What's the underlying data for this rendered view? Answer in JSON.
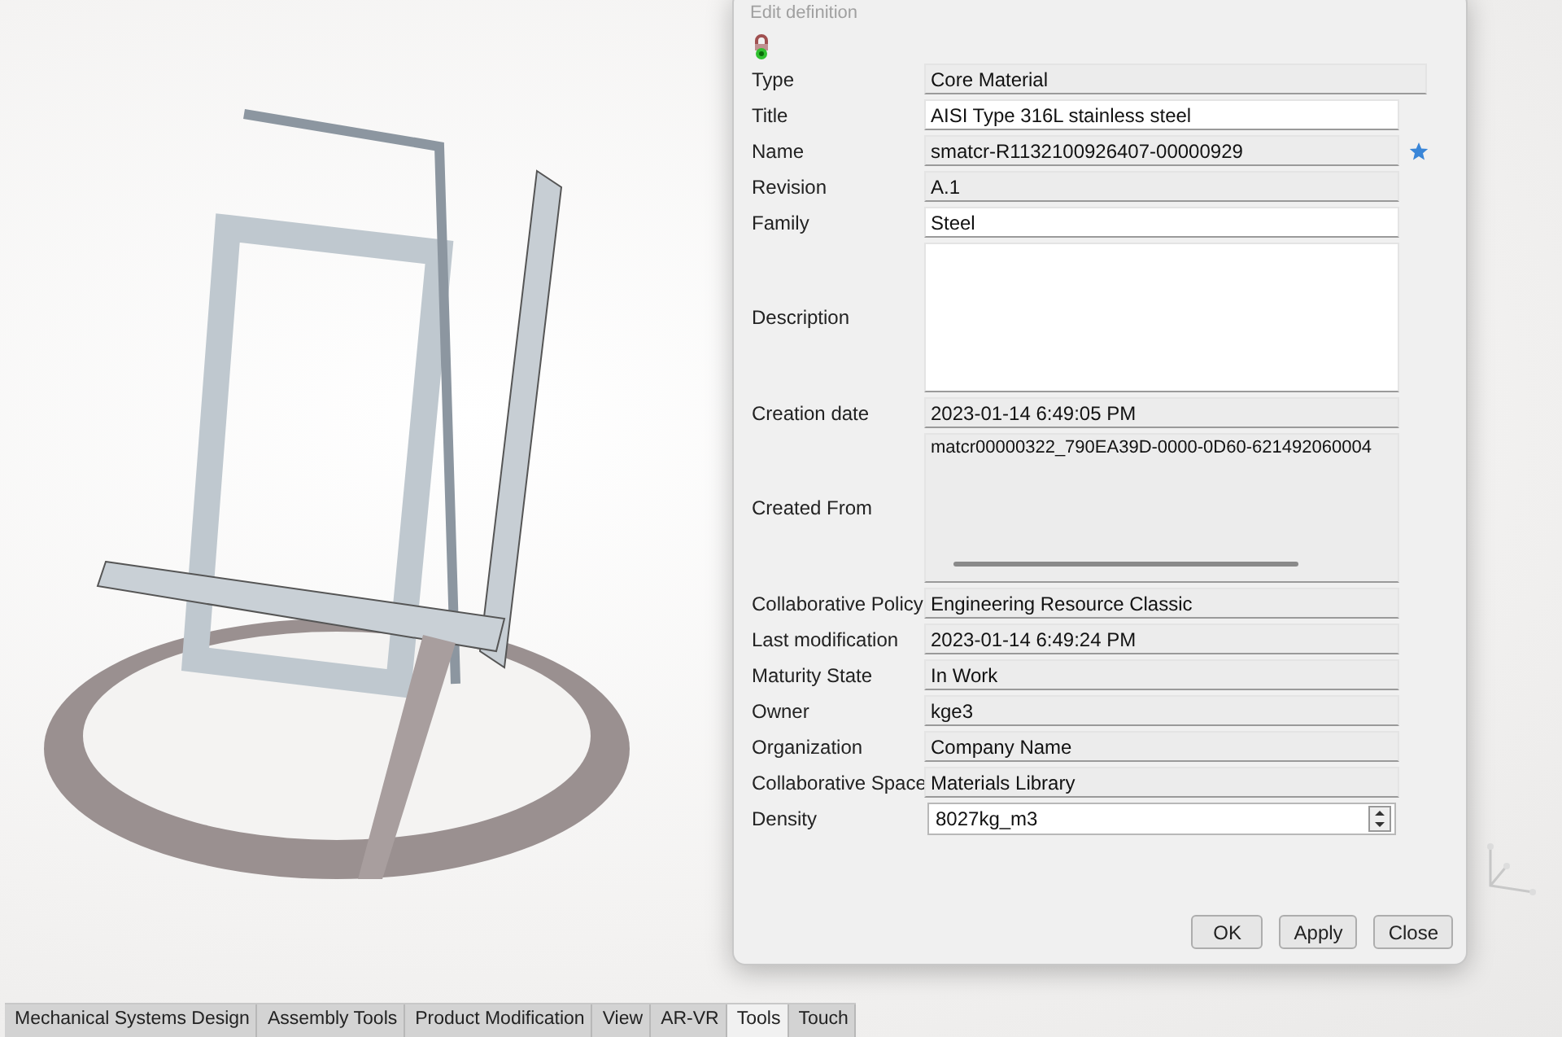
{
  "dialog": {
    "title": "Edit definition",
    "fields": [
      {
        "label": "Type",
        "value": "Core Material",
        "kind": "readonly",
        "wide": true
      },
      {
        "label": "Title",
        "value": "AISI Type 316L stainless steel",
        "kind": "text"
      },
      {
        "label": "Name",
        "value": "smatcr-R1132100926407-00000929",
        "kind": "readonly",
        "starred": true
      },
      {
        "label": "Revision",
        "value": "A.1",
        "kind": "readonly"
      },
      {
        "label": "Family",
        "value": "Steel",
        "kind": "text"
      },
      {
        "label": "Description",
        "kind": "textarea"
      },
      {
        "label": "Creation date",
        "value": "2023-01-14 6:49:05 PM",
        "kind": "readonly"
      },
      {
        "label": "Created From",
        "value": "matcr00000322_790EA39D-0000-0D60-621492060004",
        "kind": "multiline"
      },
      {
        "label": "Collaborative Policy",
        "value": "Engineering Resource Classic",
        "kind": "readonly"
      },
      {
        "label": "Last modification",
        "value": "2023-01-14 6:49:24 PM",
        "kind": "readonly"
      },
      {
        "label": "Maturity State",
        "value": "In Work",
        "kind": "readonly"
      },
      {
        "label": "Owner",
        "value": "kge3",
        "kind": "readonly"
      },
      {
        "label": "Organization",
        "value": "Company Name",
        "kind": "readonly"
      },
      {
        "label": "Collaborative Space",
        "value": "Materials Library",
        "kind": "readonly"
      },
      {
        "label": "Density",
        "value": "8027kg_m3",
        "kind": "spin"
      }
    ],
    "buttons": [
      "OK",
      "Apply",
      "Close"
    ]
  },
  "tabs": [
    {
      "label": "Mechanical Systems Design",
      "selected": false
    },
    {
      "label": "Assembly Tools",
      "selected": false
    },
    {
      "label": "Product Modification",
      "selected": false
    },
    {
      "label": "View",
      "selected": false
    },
    {
      "label": "AR-VR",
      "selected": false
    },
    {
      "label": "Tools",
      "selected": true
    },
    {
      "label": "Touch",
      "selected": false
    }
  ]
}
